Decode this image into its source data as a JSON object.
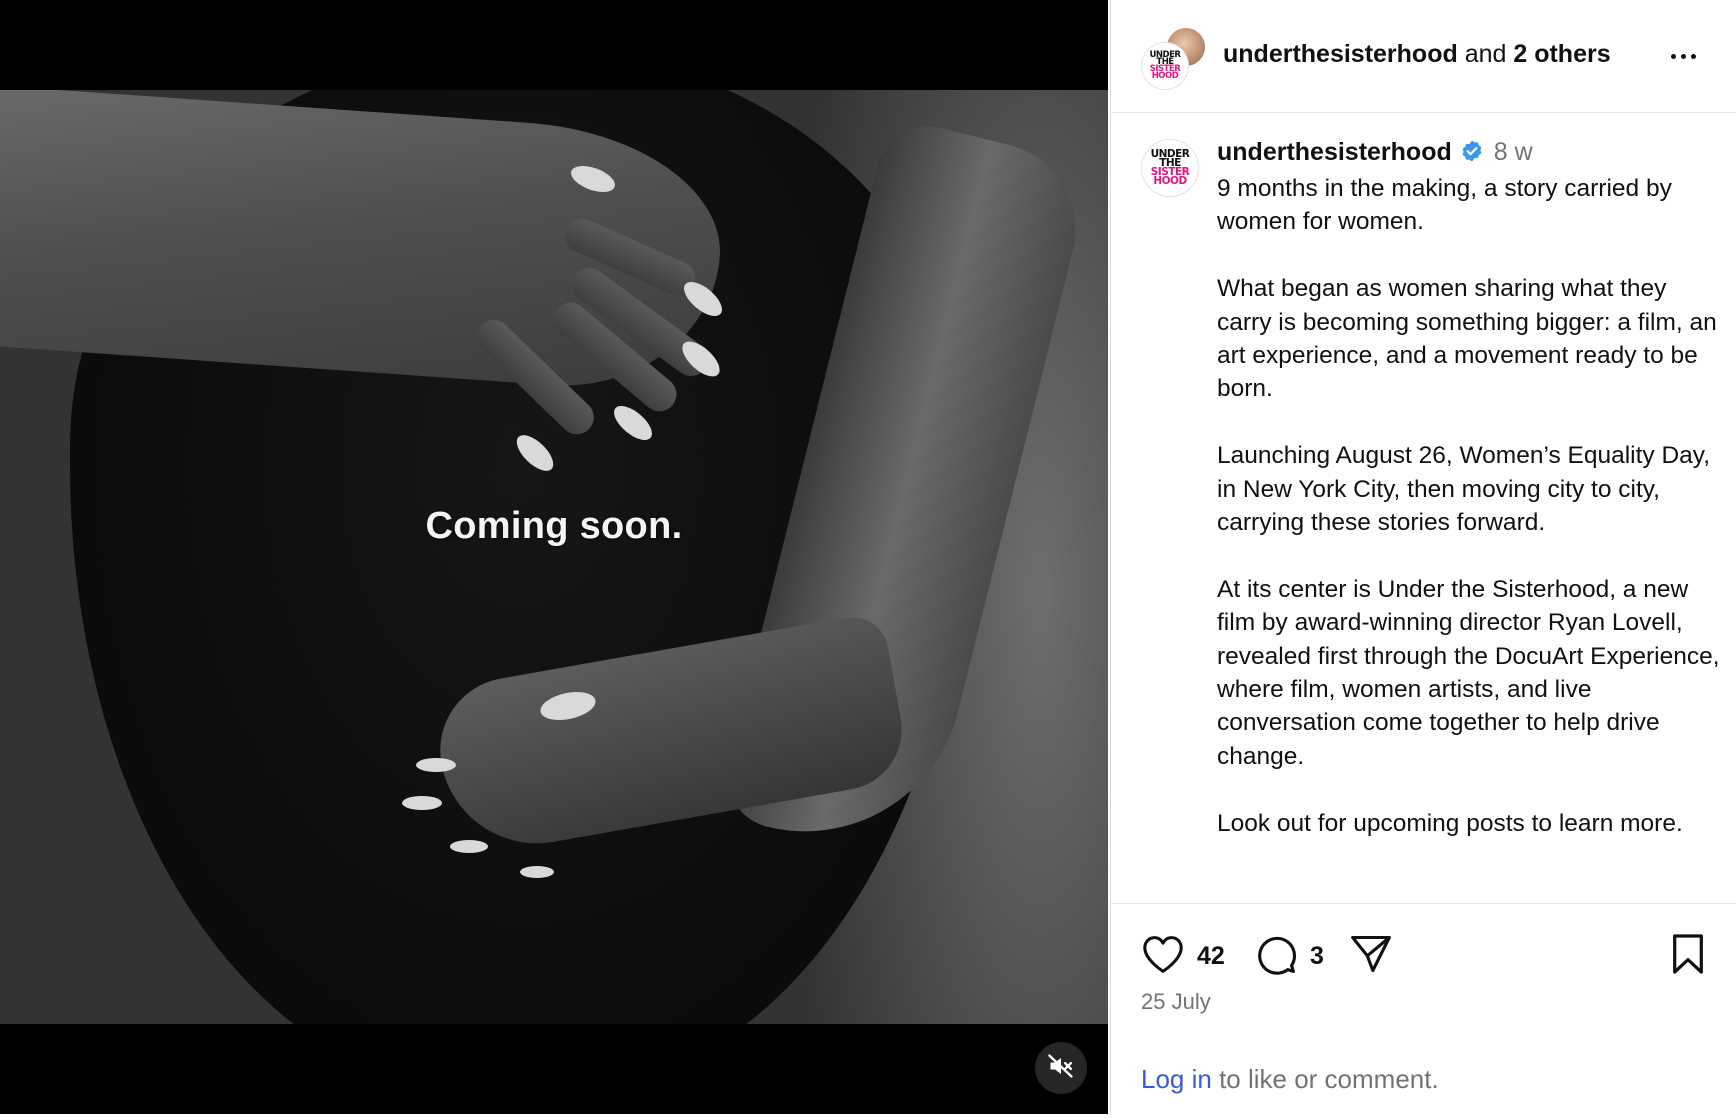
{
  "media": {
    "overlay_text": "Coming soon.",
    "mute_icon": "speaker-muted-icon"
  },
  "header": {
    "username": "underthesisterhood",
    "connector": " and ",
    "others": "2 others",
    "more_icon": "more-dots-icon"
  },
  "avatar_logo": {
    "line1": "UNDER",
    "line2": "THE",
    "line3": "SISTER",
    "line4": "HOOD"
  },
  "caption": {
    "username": "underthesisterhood",
    "verified_icon": "verified-badge-icon",
    "time": "8 w",
    "paragraphs": [
      "9 months in the making, a story carried by women for women.",
      "What began as women sharing what they carry is becoming something bigger: a film, an art experience, and a movement ready to be born.",
      "Launching August 26, Women’s Equality Day, in New York City, then moving city to city, carrying these stories forward.",
      "At its center is Under the Sisterhood, a new film by award-winning director Ryan Lovell, revealed first through the DocuArt Experience, where film, women artists, and live conversation come together to help drive change.",
      "Look out for upcoming posts to learn more."
    ]
  },
  "actions": {
    "like_icon": "heart-icon",
    "likes": "42",
    "comment_icon": "comment-bubble-icon",
    "comments": "3",
    "share_icon": "paper-plane-icon",
    "save_icon": "bookmark-icon",
    "date": "25 July"
  },
  "login": {
    "link": "Log in",
    "text": " to like or comment."
  },
  "colors": {
    "link": "#3a5bd9",
    "verified": "#3897f0",
    "logo_pink": "#e6137f",
    "secondary_text": "#737373"
  }
}
